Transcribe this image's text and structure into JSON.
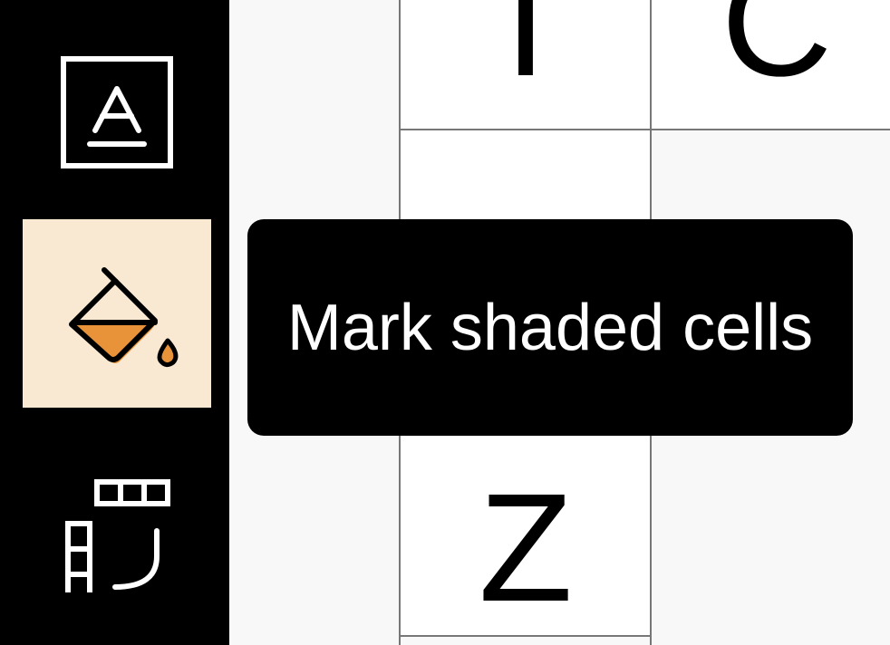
{
  "toolbar": {
    "tools": [
      {
        "name": "text-mode-tool",
        "icon": "text-letter-icon",
        "active": false
      },
      {
        "name": "shade-cells-tool",
        "icon": "paint-bucket-icon",
        "active": true
      },
      {
        "name": "clue-entry-tool",
        "icon": "grid-clue-icon",
        "active": false
      }
    ],
    "active_bg": "#f9e8d2",
    "accent": "#e8923a"
  },
  "grid": {
    "cells": [
      {
        "id": "r0c0",
        "letter": "I"
      },
      {
        "id": "r0c1",
        "letter": "C"
      },
      {
        "id": "r1c0",
        "letter": ""
      },
      {
        "id": "r2c0",
        "letter": "Z"
      }
    ]
  },
  "tooltip": {
    "text": "Mark shaded cells"
  }
}
